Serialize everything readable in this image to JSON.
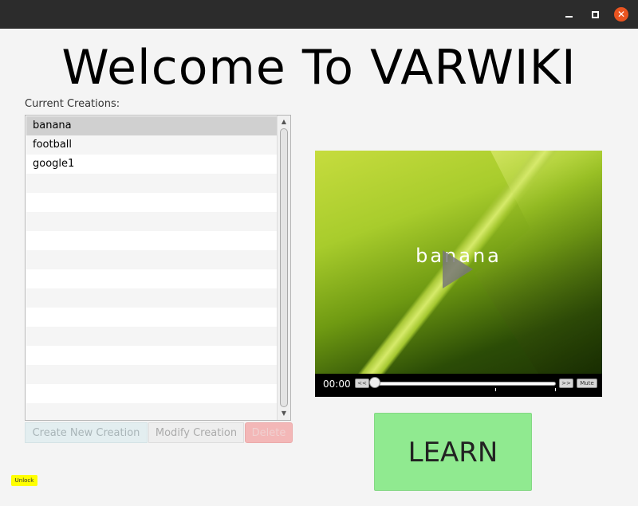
{
  "window": {
    "minimize_glyph": "",
    "maximize_glyph": "",
    "close_glyph": "✕"
  },
  "heading": "Welcome To VARWIKI",
  "creations": {
    "label": "Current Creations:",
    "items": [
      "banana",
      "football",
      "google1"
    ],
    "selected": "banana"
  },
  "buttons": {
    "create": "Create New Creation",
    "modify": "Modify Creation",
    "delete": "Delete",
    "learn": "LEARN",
    "unlock": "Unlock"
  },
  "player": {
    "caption": "banana",
    "time": "00:00",
    "rewind": "<<",
    "forward": ">>",
    "mute": "Mute",
    "progress": 0
  },
  "colors": {
    "learn_bg": "#90ea90",
    "delete_bg": "#f3b7b7",
    "unlock_bg": "#ffff00",
    "close_bg": "#e95420"
  }
}
